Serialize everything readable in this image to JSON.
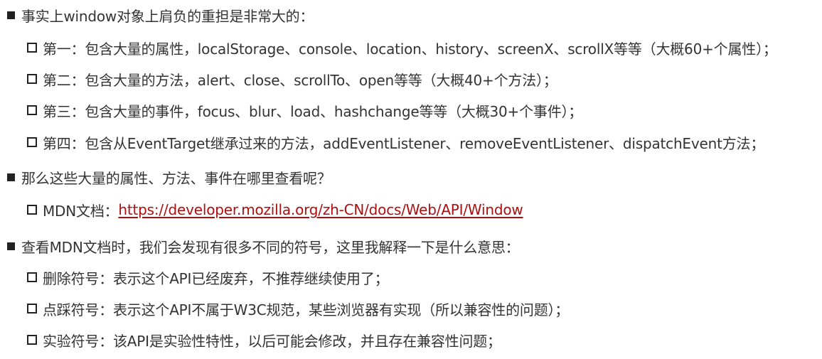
{
  "sections": [
    {
      "text": "事实上window对象上肩负的重担是非常大的：",
      "items": [
        "第一：包含大量的属性，localStorage、console、location、history、screenX、scrollX等等（大概60+个属性）；",
        "第二：包含大量的方法，alert、close、scrollTo、open等等（大概40+个方法）；",
        "第三：包含大量的事件，focus、blur、load、hashchange等等（大概30+个事件）；",
        "第四：包含从EventTarget继承过来的方法，addEventListener、removeEventListener、dispatchEvent方法；"
      ]
    },
    {
      "text": "那么这些大量的属性、方法、事件在哪里查看呢？",
      "mdn_label": "MDN文档：",
      "mdn_url": "https://developer.mozilla.org/zh-CN/docs/Web/API/Window"
    },
    {
      "text": "查看MDN文档时，我们会发现有很多不同的符号，这里我解释一下是什么意思：",
      "items": [
        "删除符号：表示这个API已经废弃，不推荐继续使用了；",
        "点踩符号：表示这个API不属于W3C规范，某些浏览器有实现（所以兼容性的问题）；",
        "实验符号：该API是实验性特性，以后可能会修改，并且存在兼容性问题；"
      ]
    }
  ]
}
